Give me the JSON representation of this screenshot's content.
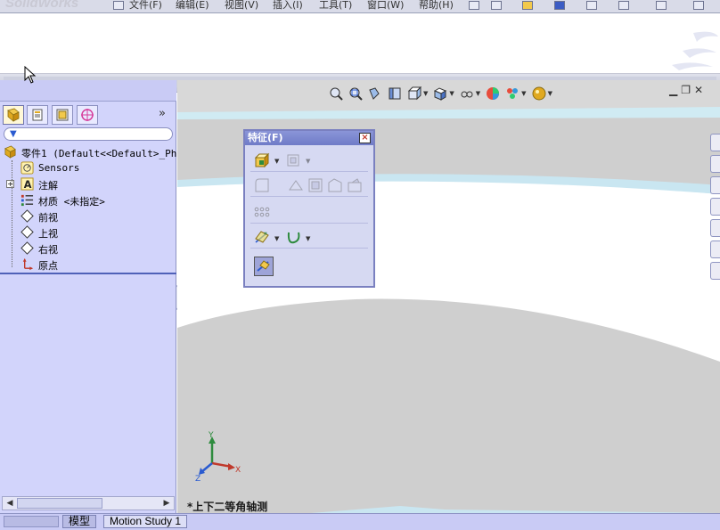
{
  "app": {
    "brand": "SolidWorks",
    "menus": [
      "文件(F)",
      "编辑(E)",
      "视图(V)",
      "插入(I)",
      "工具(T)",
      "窗口(W)",
      "帮助(H)"
    ]
  },
  "left_panel": {
    "tabs": [
      {
        "name": "featuremanager-tab",
        "icon": "tree-icon"
      },
      {
        "name": "propertymanager-tab",
        "icon": "property-icon"
      },
      {
        "name": "configurationmanager-tab",
        "icon": "config-icon"
      },
      {
        "name": "dimxpert-tab",
        "icon": "crosshair-icon"
      }
    ],
    "expand_label": "»",
    "tree": {
      "root": "零件1  (Default<<Default>_Ph",
      "items": [
        "Sensors",
        "注解",
        "材质 <未指定>",
        "前视",
        "上视",
        "右视",
        "原点"
      ]
    }
  },
  "viewport": {
    "view_label": "*上下二等角轴测",
    "triad": {
      "x": "X",
      "y": "Y",
      "z": "Z"
    }
  },
  "feature_toolbar": {
    "title": "特征(F)",
    "close": "×"
  },
  "bottom_tabs": [
    "模型",
    "Motion Study 1"
  ]
}
